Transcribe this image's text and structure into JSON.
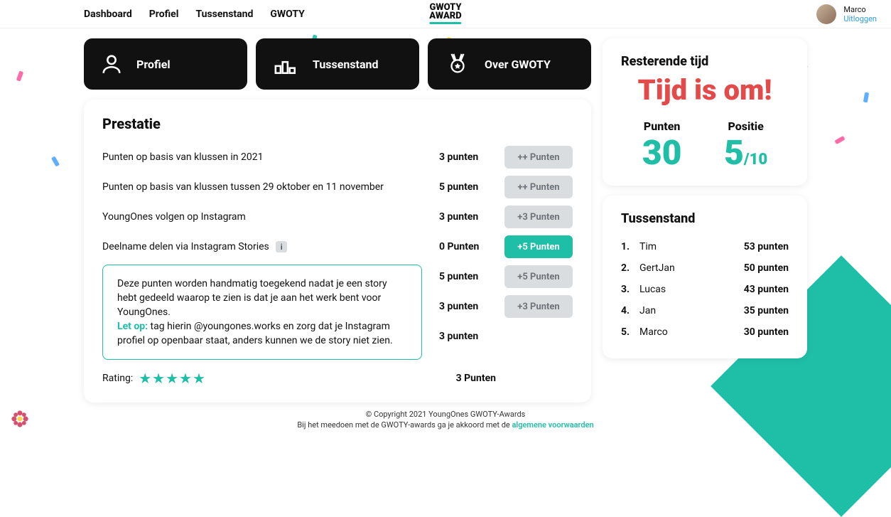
{
  "nav": {
    "dashboard": "Dashboard",
    "profiel": "Profiel",
    "tussenstand": "Tussenstand",
    "gwoty": "GWOTY"
  },
  "logo": {
    "l1": "GWOTY",
    "l2": "AWARD"
  },
  "user": {
    "name": "Marco",
    "logout": "Uitloggen"
  },
  "tabs": {
    "profiel": "Profiel",
    "tussenstand": "Tussenstand",
    "over": "Over GWOTY"
  },
  "prestatie": {
    "title": "Prestatie",
    "rows": [
      {
        "label": "Punten op basis van klussen in 2021",
        "pts": "3 punten",
        "btn": "++ Punten",
        "active": false
      },
      {
        "label": "Punten op basis van klussen tussen 29 oktober en 11 november",
        "pts": "5 punten",
        "btn": "++ Punten",
        "active": false
      },
      {
        "label": "YoungOnes volgen op Instagram",
        "pts": "3 punten",
        "btn": "+3 Punten",
        "active": false
      },
      {
        "label": "Deelname delen via Instagram Stories",
        "pts": "0 Punten",
        "btn": "+5 Punten",
        "active": true,
        "info": true
      },
      {
        "label": "",
        "pts": "5 punten",
        "btn": "+5 Punten",
        "active": false
      },
      {
        "label": "",
        "pts": "3 punten",
        "btn": "+3 Punten",
        "active": false
      },
      {
        "label": "",
        "pts": "3 punten",
        "btn": "",
        "active": false
      }
    ],
    "tooltip": {
      "body": "Deze punten worden handmatig toegekend nadat je een story hebt gedeeld waarop te zien is dat je aan het werk bent voor YoungOnes.",
      "letop": "Let op:",
      "body2": " tag hierin @youngones.works en zorg dat je Instagram profiel op openbaar staat, anders kunnen we de story niet zien."
    },
    "rating": {
      "label": "Rating:",
      "pts": "3 Punten"
    }
  },
  "time": {
    "title": "Resterende tijd",
    "big": "Tijd is om!",
    "punten_label": "Punten",
    "punten_value": "30",
    "positie_label": "Positie",
    "positie_value": "5",
    "positie_denom": "/10"
  },
  "leader": {
    "title": "Tussenstand",
    "rows": [
      {
        "rank": "1.",
        "name": "Tim",
        "pts": "53 punten"
      },
      {
        "rank": "2.",
        "name": "GertJan",
        "pts": "50 punten"
      },
      {
        "rank": "3.",
        "name": "Lucas",
        "pts": "43 punten"
      },
      {
        "rank": "4.",
        "name": "Jan",
        "pts": "35 punten"
      },
      {
        "rank": "5.",
        "name": "Marco",
        "pts": "30 punten"
      }
    ]
  },
  "footer": {
    "l1": "© Copyright 2021 YoungOnes GWOTY-Awards",
    "l2a": "Bij het meedoen met de GWOTY-awards ga je akkoord met de ",
    "l2b": "algemene voorwaarden"
  }
}
